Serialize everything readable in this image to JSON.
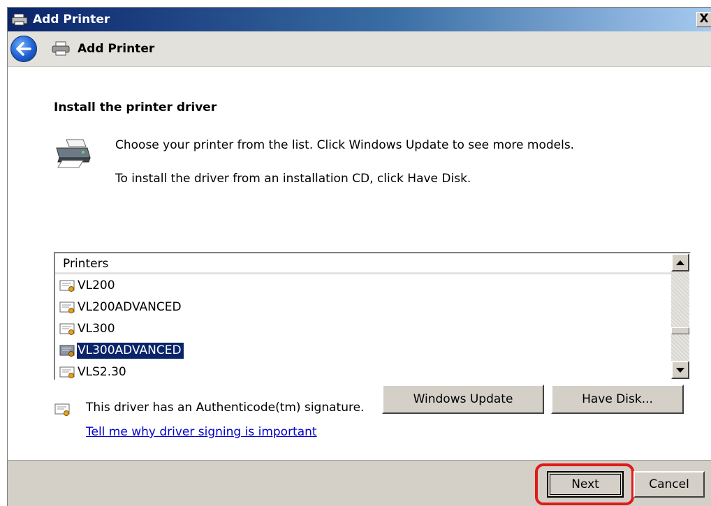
{
  "window": {
    "title": "Add Printer",
    "close_glyph": "X"
  },
  "nav": {
    "title": "Add Printer",
    "back_icon": "back-arrow-icon",
    "printer_icon": "printer-icon"
  },
  "page": {
    "heading": "Install the printer driver",
    "description_1": "Choose your printer from the list. Click Windows Update to see more models.",
    "description_2": "To install the driver from an installation CD, click Have Disk."
  },
  "printer_list": {
    "header": "Printers",
    "items": [
      {
        "label": "VL200",
        "selected": false
      },
      {
        "label": "VL200ADVANCED",
        "selected": false
      },
      {
        "label": "VL300",
        "selected": false
      },
      {
        "label": "VL300ADVANCED",
        "selected": true
      },
      {
        "label": "VLS2.30",
        "selected": false
      }
    ]
  },
  "signature": {
    "text": "This driver has an Authenticode(tm) signature.",
    "link": "Tell me why driver signing is important"
  },
  "buttons": {
    "windows_update": "Windows Update",
    "have_disk": "Have Disk...",
    "next": "Next",
    "cancel": "Cancel"
  },
  "colors": {
    "selection": "#0a246a",
    "link": "#0000cc",
    "highlight_ring": "#e01a1a"
  }
}
